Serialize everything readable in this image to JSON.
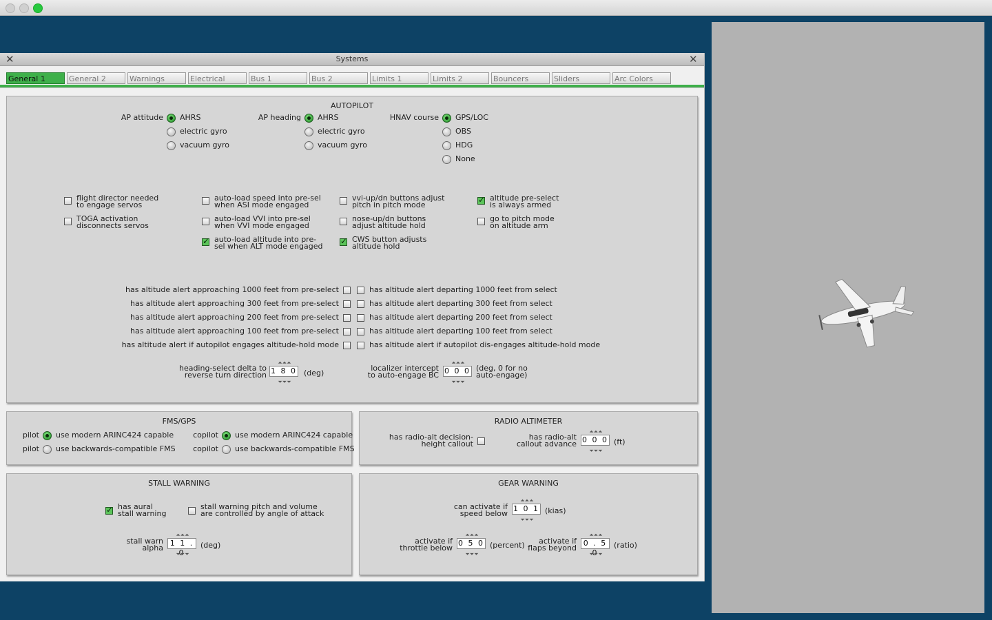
{
  "window": {
    "title": "Systems"
  },
  "tabs": [
    "General 1",
    "General 2",
    "Warnings",
    "Electrical",
    "Bus 1",
    "Bus 2",
    "Limits 1",
    "Limits 2",
    "Bouncers",
    "Sliders",
    "Arc Colors"
  ],
  "active_tab": "General 1",
  "colors": {
    "desktop": "#0d4265",
    "accent_green": "#3eb04a",
    "panel": "#d6d6d6"
  },
  "autopilot": {
    "title": "AUTOPILOT",
    "ap_attitude": {
      "label": "AP attitude",
      "options": [
        "AHRS",
        "electric gyro",
        "vacuum gyro"
      ],
      "selected": "AHRS"
    },
    "ap_heading": {
      "label": "AP heading",
      "options": [
        "AHRS",
        "electric gyro",
        "vacuum gyro"
      ],
      "selected": "AHRS"
    },
    "hnav_course": {
      "label": "HNAV course",
      "options": [
        "GPS/LOC",
        "OBS",
        "HDG",
        "None"
      ],
      "selected": "GPS/LOC"
    },
    "checks": [
      {
        "l1": "flight director needed",
        "l2": "to engage servos",
        "checked": false
      },
      {
        "l1": "TOGA activation",
        "l2": "disconnects servos",
        "checked": false
      },
      {
        "l1": "auto-load speed into pre-sel",
        "l2": "when ASI mode engaged",
        "checked": false
      },
      {
        "l1": "auto-load VVI into pre-sel",
        "l2": "when VVI mode engaged",
        "checked": false
      },
      {
        "l1": "auto-load altitude into pre-",
        "l2": "sel when ALT mode engaged",
        "checked": true
      },
      {
        "l1": "vvi-up/dn buttons adjust",
        "l2": "pitch in pitch mode",
        "checked": false
      },
      {
        "l1": "nose-up/dn buttons",
        "l2": "adjust altitude hold",
        "checked": false
      },
      {
        "l1": "CWS button adjusts",
        "l2": "altitude hold",
        "checked": true
      },
      {
        "l1": "altitude pre-select",
        "l2": "is always armed",
        "checked": true
      },
      {
        "l1": "go to pitch mode",
        "l2": "on altitude arm",
        "checked": false
      }
    ],
    "alerts": [
      {
        "left": "has altitude alert approaching 1000 feet from pre-select",
        "right": "has altitude alert departing 1000 feet from select"
      },
      {
        "left": "has altitude alert approaching 300 feet from pre-select",
        "right": "has altitude alert departing 300 feet from select"
      },
      {
        "left": "has altitude alert approaching 200 feet from pre-select",
        "right": "has altitude alert departing 200 feet from select"
      },
      {
        "left": "has altitude alert approaching 100 feet from pre-select",
        "right": "has altitude alert departing 100 feet from select"
      },
      {
        "left": "has altitude alert if autopilot engages altitude-hold mode",
        "right": "has altitude alert if autopilot dis-engages altitude-hold mode"
      }
    ],
    "heading_delta": {
      "l1": "heading-select delta to",
      "l2": "reverse turn direction",
      "value": "180",
      "unit": "(deg)"
    },
    "localizer": {
      "l1": "localizer intercept",
      "l2": "to auto-engage BC",
      "value": "000",
      "unit1": "(deg, 0 for no",
      "unit2": "auto-engage)"
    }
  },
  "fms": {
    "title": "FMS/GPS",
    "pilot_label": "pilot",
    "copilot_label": "copilot",
    "opt_modern": "use modern ARINC424 capable",
    "opt_legacy": "use backwards-compatible FMS",
    "pilot_selected": "modern",
    "copilot_selected": "modern"
  },
  "radio_alt": {
    "title": "RADIO ALTIMETER",
    "dh_l1": "has radio-alt decision-",
    "dh_l2": "height callout",
    "dh_checked": false,
    "adv_l1": "has radio-alt",
    "adv_l2": "callout advance",
    "adv_value": "000",
    "adv_unit": "(ft)"
  },
  "stall": {
    "title": "STALL WARNING",
    "aural_l1": "has aural",
    "aural_l2": "stall warning",
    "aural_checked": true,
    "aoa_l1": "stall warning pitch and volume",
    "aoa_l2": "are controlled by angle of attack",
    "aoa_checked": false,
    "alpha_l1": "stall warn",
    "alpha_l2": "alpha",
    "alpha_value": "11.0",
    "alpha_unit": "(deg)"
  },
  "gear": {
    "title": "GEAR WARNING",
    "speed_l1": "can activate if",
    "speed_l2": "speed below",
    "speed_value": "101",
    "speed_unit": "(kias)",
    "thr_l1": "activate if",
    "thr_l2": "throttle below",
    "thr_value": "050",
    "thr_unit": "(percent)",
    "flaps_l1": "activate if",
    "flaps_l2": "flaps beyond",
    "flaps_value": "0.50",
    "flaps_unit": "(ratio)"
  }
}
